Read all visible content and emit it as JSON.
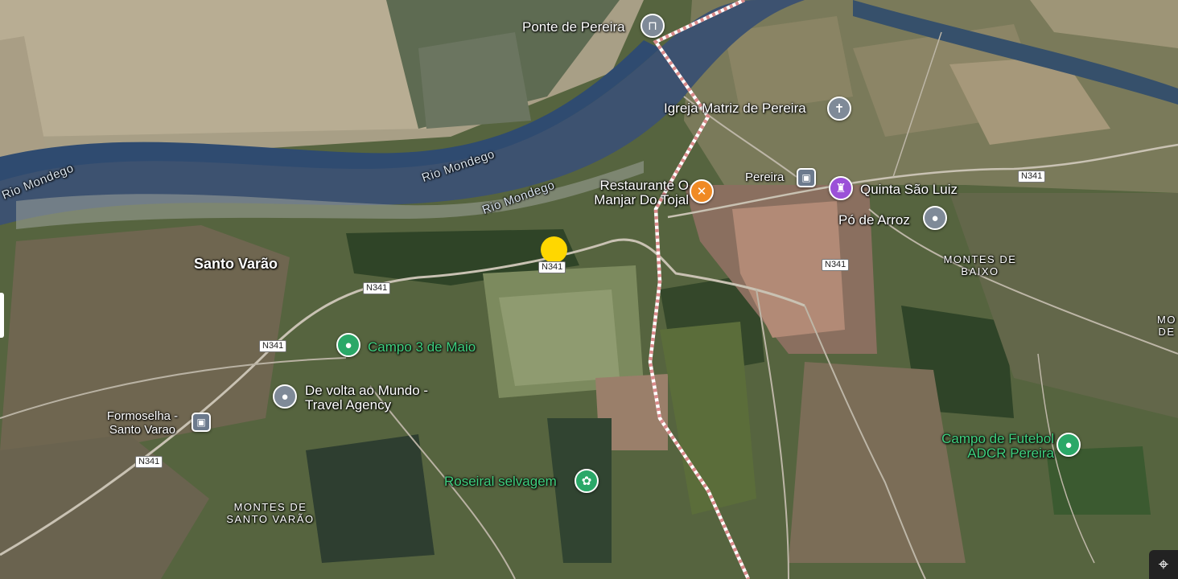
{
  "map": {
    "place_labels": {
      "ponte_de_pereira": "Ponte de Pereira",
      "igreja_matriz": "Igreja Matriz de Pereira",
      "restaurante": "Restaurante O Manjar Do Tojal",
      "pereira": "Pereira",
      "quinta_sao_luiz": "Quinta São Luiz",
      "po_de_arroz": "Pó de Arroz",
      "santo_varao": "Santo Varão",
      "campo_3_de_maio": "Campo 3 de Maio",
      "de_volta_ao_mundo": "De volta ao Mundo - Travel Agency",
      "formoselha": "Formoselha - Santo Varao",
      "roseiral": "Roseiral selvagem",
      "campo_futebol": "Campo de Futebol ADCR Pereira",
      "montes_de_baixo": "MONTES DE BAIXO",
      "montes_de_santo_varao": "MONTES DE SANTO VARÃO",
      "edge_montes": "MO DE"
    },
    "rivers": [
      "Rio Mondego",
      "Rio Mondego",
      "Rio Mondego"
    ],
    "road_badges": [
      "N341",
      "N341",
      "N341",
      "N341",
      "N341",
      "N341"
    ],
    "icons": {
      "bridge": "bridge-icon",
      "church": "church-icon",
      "restaurant": "restaurant-icon",
      "transit": "bus-icon",
      "castle": "palace-icon",
      "generic": "location-pin-icon",
      "stadium": "stadium-icon",
      "flower": "flower-icon",
      "locate": "my-location-icon"
    },
    "colors": {
      "selected_marker": "#ffd700",
      "boundary": "#e8a0a0",
      "green_poi": "#2aa868",
      "orange_poi": "#f08a24",
      "purple_poi": "#9b50d8"
    }
  }
}
